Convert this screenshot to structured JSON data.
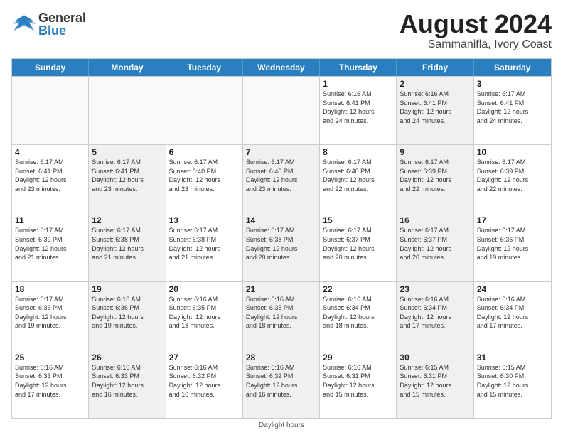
{
  "header": {
    "title": "August 2024",
    "subtitle": "Sammanifla, Ivory Coast",
    "logo_general": "General",
    "logo_blue": "Blue"
  },
  "days_of_week": [
    "Sunday",
    "Monday",
    "Tuesday",
    "Wednesday",
    "Thursday",
    "Friday",
    "Saturday"
  ],
  "footer": {
    "daylight_note": "Daylight hours"
  },
  "weeks": [
    [
      {
        "day": "",
        "empty": true
      },
      {
        "day": "",
        "empty": true
      },
      {
        "day": "",
        "empty": true
      },
      {
        "day": "",
        "empty": true
      },
      {
        "day": "1",
        "info": "Sunrise: 6:16 AM\nSunset: 6:41 PM\nDaylight: 12 hours\nand 24 minutes."
      },
      {
        "day": "2",
        "info": "Sunrise: 6:16 AM\nSunset: 6:41 PM\nDaylight: 12 hours\nand 24 minutes.",
        "shaded": true
      },
      {
        "day": "3",
        "info": "Sunrise: 6:17 AM\nSunset: 6:41 PM\nDaylight: 12 hours\nand 24 minutes."
      }
    ],
    [
      {
        "day": "4",
        "info": "Sunrise: 6:17 AM\nSunset: 6:41 PM\nDaylight: 12 hours\nand 23 minutes."
      },
      {
        "day": "5",
        "info": "Sunrise: 6:17 AM\nSunset: 6:41 PM\nDaylight: 12 hours\nand 23 minutes.",
        "shaded": true
      },
      {
        "day": "6",
        "info": "Sunrise: 6:17 AM\nSunset: 6:40 PM\nDaylight: 12 hours\nand 23 minutes."
      },
      {
        "day": "7",
        "info": "Sunrise: 6:17 AM\nSunset: 6:40 PM\nDaylight: 12 hours\nand 23 minutes.",
        "shaded": true
      },
      {
        "day": "8",
        "info": "Sunrise: 6:17 AM\nSunset: 6:40 PM\nDaylight: 12 hours\nand 22 minutes."
      },
      {
        "day": "9",
        "info": "Sunrise: 6:17 AM\nSunset: 6:39 PM\nDaylight: 12 hours\nand 22 minutes.",
        "shaded": true
      },
      {
        "day": "10",
        "info": "Sunrise: 6:17 AM\nSunset: 6:39 PM\nDaylight: 12 hours\nand 22 minutes."
      }
    ],
    [
      {
        "day": "11",
        "info": "Sunrise: 6:17 AM\nSunset: 6:39 PM\nDaylight: 12 hours\nand 21 minutes."
      },
      {
        "day": "12",
        "info": "Sunrise: 6:17 AM\nSunset: 6:38 PM\nDaylight: 12 hours\nand 21 minutes.",
        "shaded": true
      },
      {
        "day": "13",
        "info": "Sunrise: 6:17 AM\nSunset: 6:38 PM\nDaylight: 12 hours\nand 21 minutes."
      },
      {
        "day": "14",
        "info": "Sunrise: 6:17 AM\nSunset: 6:38 PM\nDaylight: 12 hours\nand 20 minutes.",
        "shaded": true
      },
      {
        "day": "15",
        "info": "Sunrise: 6:17 AM\nSunset: 6:37 PM\nDaylight: 12 hours\nand 20 minutes."
      },
      {
        "day": "16",
        "info": "Sunrise: 6:17 AM\nSunset: 6:37 PM\nDaylight: 12 hours\nand 20 minutes.",
        "shaded": true
      },
      {
        "day": "17",
        "info": "Sunrise: 6:17 AM\nSunset: 6:36 PM\nDaylight: 12 hours\nand 19 minutes."
      }
    ],
    [
      {
        "day": "18",
        "info": "Sunrise: 6:17 AM\nSunset: 6:36 PM\nDaylight: 12 hours\nand 19 minutes."
      },
      {
        "day": "19",
        "info": "Sunrise: 6:16 AM\nSunset: 6:36 PM\nDaylight: 12 hours\nand 19 minutes.",
        "shaded": true
      },
      {
        "day": "20",
        "info": "Sunrise: 6:16 AM\nSunset: 6:35 PM\nDaylight: 12 hours\nand 18 minutes."
      },
      {
        "day": "21",
        "info": "Sunrise: 6:16 AM\nSunset: 6:35 PM\nDaylight: 12 hours\nand 18 minutes.",
        "shaded": true
      },
      {
        "day": "22",
        "info": "Sunrise: 6:16 AM\nSunset: 6:34 PM\nDaylight: 12 hours\nand 18 minutes."
      },
      {
        "day": "23",
        "info": "Sunrise: 6:16 AM\nSunset: 6:34 PM\nDaylight: 12 hours\nand 17 minutes.",
        "shaded": true
      },
      {
        "day": "24",
        "info": "Sunrise: 6:16 AM\nSunset: 6:34 PM\nDaylight: 12 hours\nand 17 minutes."
      }
    ],
    [
      {
        "day": "25",
        "info": "Sunrise: 6:16 AM\nSunset: 6:33 PM\nDaylight: 12 hours\nand 17 minutes."
      },
      {
        "day": "26",
        "info": "Sunrise: 6:16 AM\nSunset: 6:33 PM\nDaylight: 12 hours\nand 16 minutes.",
        "shaded": true
      },
      {
        "day": "27",
        "info": "Sunrise: 6:16 AM\nSunset: 6:32 PM\nDaylight: 12 hours\nand 16 minutes."
      },
      {
        "day": "28",
        "info": "Sunrise: 6:16 AM\nSunset: 6:32 PM\nDaylight: 12 hours\nand 16 minutes.",
        "shaded": true
      },
      {
        "day": "29",
        "info": "Sunrise: 6:16 AM\nSunset: 6:31 PM\nDaylight: 12 hours\nand 15 minutes."
      },
      {
        "day": "30",
        "info": "Sunrise: 6:15 AM\nSunset: 6:31 PM\nDaylight: 12 hours\nand 15 minutes.",
        "shaded": true
      },
      {
        "day": "31",
        "info": "Sunrise: 6:15 AM\nSunset: 6:30 PM\nDaylight: 12 hours\nand 15 minutes."
      }
    ]
  ]
}
